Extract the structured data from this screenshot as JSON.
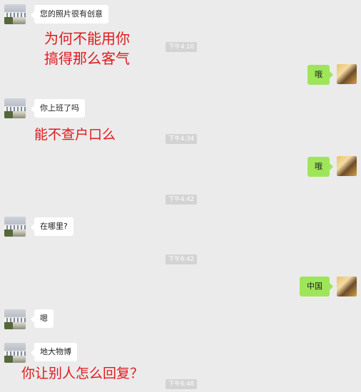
{
  "messages": {
    "m1": "您的照片很有创意",
    "m2": "哦",
    "m3": "你上班了吗",
    "m4": "哦",
    "m5": "在哪里?",
    "m6": "中国",
    "m7": "嗯",
    "m8": "地大物博"
  },
  "timestamps": {
    "t1": "下午4:10",
    "t2": "下午4:34",
    "t3": "下午4:42",
    "t4": "下午6:42",
    "t5": "下午6:48"
  },
  "captions": {
    "c1_line1": "为何不能用你",
    "c1_line2": "搞得那么客气",
    "c2": "能不查户口么",
    "c3": "你让别人怎么回复？"
  },
  "colors": {
    "chat_background": "#ebebeb",
    "sent_bubble": "#9fe55a",
    "received_bubble": "#ffffff",
    "caption_red": "#e0191d"
  }
}
